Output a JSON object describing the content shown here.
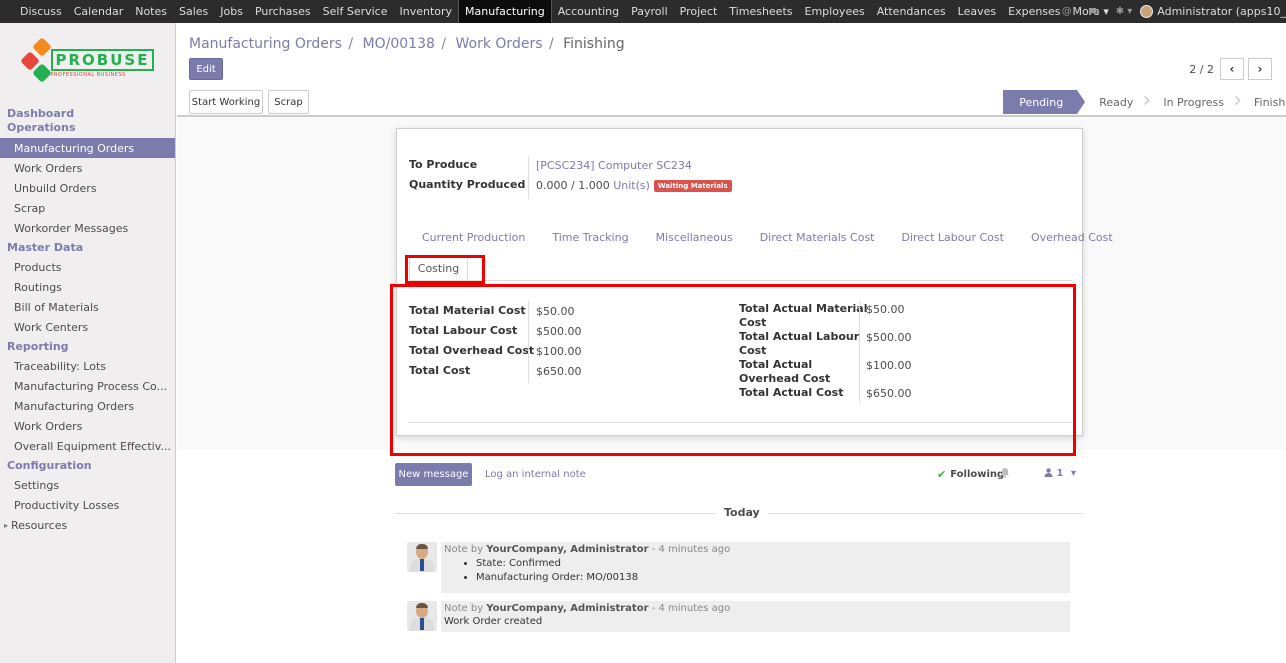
{
  "topbar": {
    "menu": [
      "Discuss",
      "Calendar",
      "Notes",
      "Sales",
      "Jobs",
      "Purchases",
      "Self Service",
      "Inventory",
      "Manufacturing",
      "Accounting",
      "Payroll",
      "Project",
      "Timesheets",
      "Employees",
      "Attendances",
      "Leaves",
      "Expenses",
      "More"
    ],
    "active": "Manufacturing",
    "user": "Administrator (apps10_"
  },
  "logo": {
    "title": "PROBUSE",
    "subtitle": "PROFESSIONAL BUSINESS"
  },
  "sidebar": {
    "sections": [
      {
        "title": "Dashboard Operations",
        "items": [
          "Manufacturing Orders",
          "Work Orders",
          "Unbuild Orders",
          "Scrap",
          "Workorder Messages"
        ]
      },
      {
        "title": "Master Data",
        "items": [
          "Products",
          "Routings",
          "Bill of Materials",
          "Work Centers"
        ]
      },
      {
        "title": "Reporting",
        "items": [
          "Traceability: Lots",
          "Manufacturing Process Co...",
          "Manufacturing Orders",
          "Work Orders",
          "Overall Equipment Effectiv..."
        ]
      },
      {
        "title": "Configuration",
        "items": [
          "Settings",
          "Productivity Losses"
        ]
      }
    ],
    "resources": "Resources"
  },
  "breadcrumb": {
    "b1": "Manufacturing Orders",
    "b2": "MO/00138",
    "b3": "Work Orders",
    "b4": "Finishing"
  },
  "buttons": {
    "edit": "Edit",
    "start_working": "Start Working",
    "scrap": "Scrap"
  },
  "pager": {
    "value": "2 / 2"
  },
  "stages": [
    "Pending",
    "Ready",
    "In Progress",
    "Finished"
  ],
  "form": {
    "to_produce_label": "To Produce",
    "to_produce_value": "[PCSC234] Computer SC234",
    "qty_label": "Quantity Produced",
    "qty_done": "0.000",
    "qty_total": "1.000",
    "qty_uom": "Unit(s)",
    "badge": "Waiting Materials",
    "tabs": [
      "Current Production",
      "Time Tracking",
      "Miscellaneous",
      "Direct Materials Cost",
      "Direct Labour Cost",
      "Overhead Cost"
    ],
    "active_tab": "Costing",
    "left": [
      {
        "label": "Total Material Cost",
        "value": "$50.00"
      },
      {
        "label": "Total Labour Cost",
        "value": "$500.00"
      },
      {
        "label": "Total Overhead Cost",
        "value": "$100.00"
      },
      {
        "label": "Total Cost",
        "value": "$650.00"
      }
    ],
    "right": [
      {
        "label1": "Total Actual Material",
        "label2": "Cost",
        "value": "$50.00"
      },
      {
        "label1": "Total Actual Labour",
        "label2": "Cost",
        "value": "$500.00"
      },
      {
        "label1": "Total Actual",
        "label2": "Overhead Cost",
        "value": "$100.00"
      },
      {
        "label1": "Total Actual Cost",
        "label2": "",
        "value": "$650.00"
      }
    ]
  },
  "chatter": {
    "new_message": "New message",
    "log_note": "Log an internal note",
    "following": "Following",
    "followers": "1",
    "today": "Today",
    "messages": [
      {
        "prefix": "Note by ",
        "author": "YourCompany, Administrator",
        "time": " - 4 minutes ago",
        "lines": [
          "State: Confirmed",
          "Manufacturing Order: MO/00138"
        ]
      },
      {
        "prefix": "Note by ",
        "author": "YourCompany, Administrator",
        "time": " - 4 minutes ago",
        "body": "Work Order created"
      }
    ]
  },
  "colors": {
    "primary": "#7c7bad",
    "topbar": "#2c2c2c",
    "badge": "#d9534f",
    "highlight": "#e00000"
  }
}
